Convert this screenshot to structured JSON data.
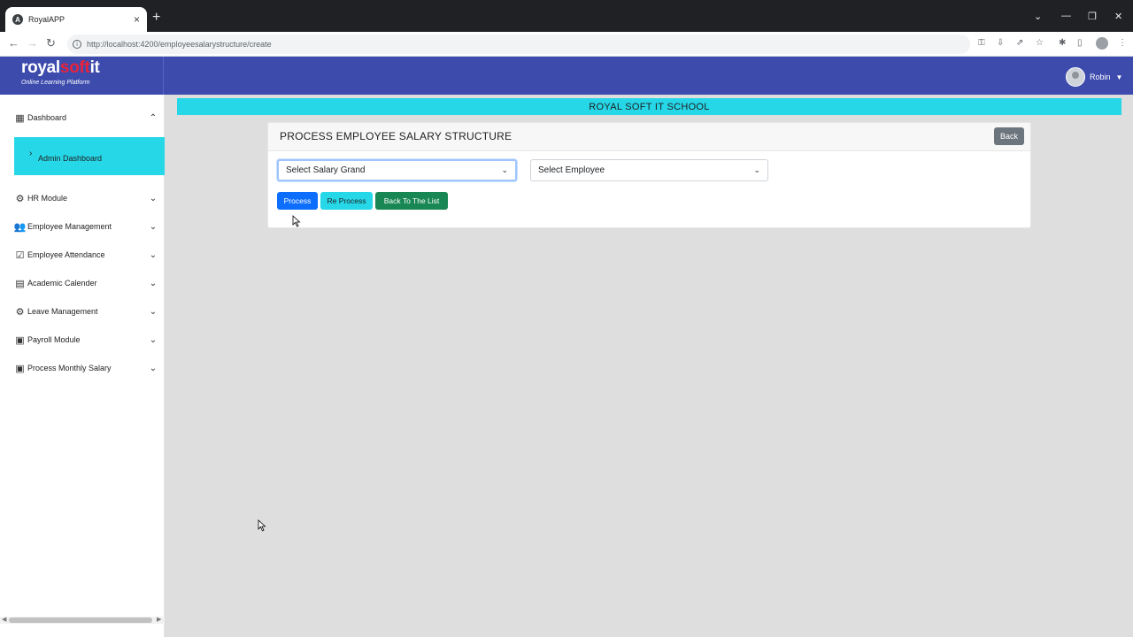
{
  "browser": {
    "tab_title": "RoyalAPP",
    "url": "http://localhost:4200/employeesalarystructure/create"
  },
  "header": {
    "brand_part1": "royal",
    "brand_part2": "soft",
    "brand_part3": "it",
    "tagline": "Online Learning Platform",
    "user_name": "Robin"
  },
  "sidebar": {
    "items": [
      {
        "label": "Dashboard",
        "icon": "dashboard-icon"
      },
      {
        "label": "HR Module",
        "icon": "hr-icon"
      },
      {
        "label": "Employee Management",
        "icon": "people-icon"
      },
      {
        "label": "Employee Attendance",
        "icon": "calendar-check-icon"
      },
      {
        "label": "Academic Calender",
        "icon": "calendar-icon"
      },
      {
        "label": "Leave Management",
        "icon": "gear-icon"
      },
      {
        "label": "Payroll Module",
        "icon": "money-icon"
      },
      {
        "label": "Process Monthly Salary",
        "icon": "money-icon"
      }
    ],
    "sub_item": "Admin Dashboard"
  },
  "main": {
    "school_name": "ROYAL SOFT IT SCHOOL",
    "card_title": "PROCESS EMPLOYEE SALARY STRUCTURE",
    "back_label": "Back",
    "salary_grade_value": "Select Salary Grand",
    "employee_value": "Select Employee",
    "process_label": "Process",
    "reprocess_label": "Re Process",
    "back_list_label": "Back To The List"
  },
  "colors": {
    "header_bg": "#3d4bad",
    "accent_cyan": "#26d7e8",
    "primary": "#0d6efd",
    "success": "#198754",
    "secondary": "#6c757d"
  }
}
